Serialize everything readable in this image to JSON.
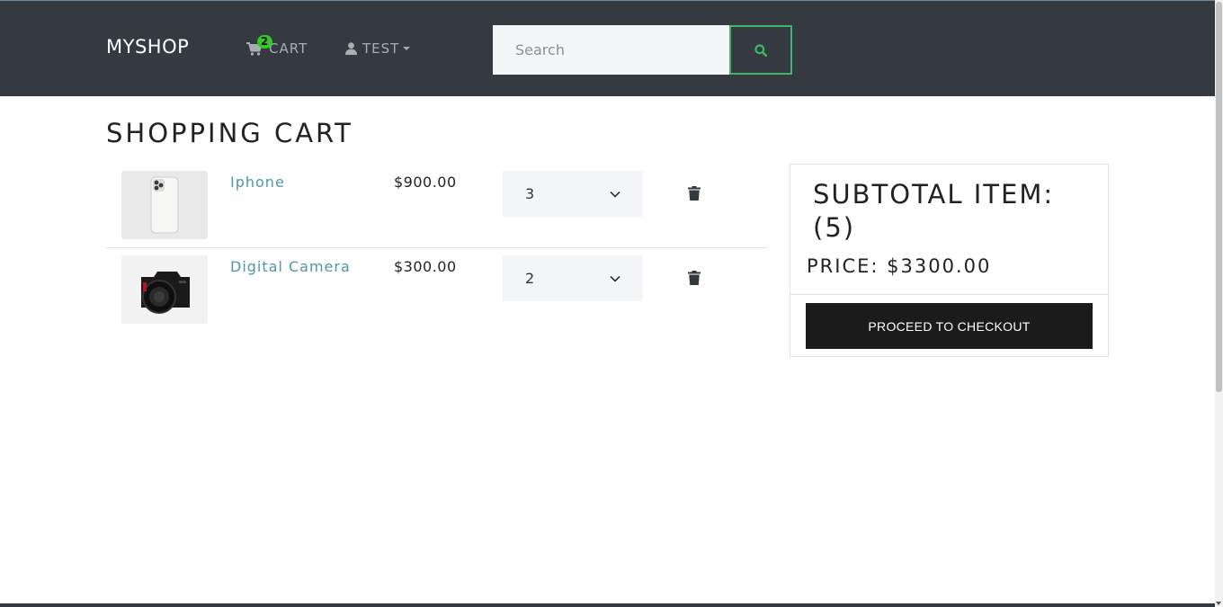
{
  "navbar": {
    "brand": "MYSHOP",
    "cart_label": "CART",
    "cart_count": "2",
    "user_label": "TEST",
    "search_placeholder": "Search"
  },
  "page_title": "SHOPPING CART",
  "cart": {
    "items": [
      {
        "name": "Iphone",
        "price": "$900.00",
        "qty": "3",
        "image": "iphone-photo"
      },
      {
        "name": "Digital Camera",
        "price": "$300.00",
        "qty": "2",
        "image": "camera-photo"
      }
    ]
  },
  "summary": {
    "subtotal": "SUBTOTAL ITEM: (5)",
    "price": "PRICE: $3300.00",
    "checkout_label": "PROCEED TO CHECKOUT"
  },
  "colors": {
    "navbar_bg": "#343a40",
    "link": "#4f96a8",
    "accent_green": "#3cb864",
    "badge": "#34c924",
    "checkout_bg": "#1b1b1b"
  },
  "icons": [
    "shopping-cart-icon",
    "user-icon",
    "caret-down-icon",
    "search-icon",
    "chevron-down-icon",
    "trash-icon"
  ]
}
